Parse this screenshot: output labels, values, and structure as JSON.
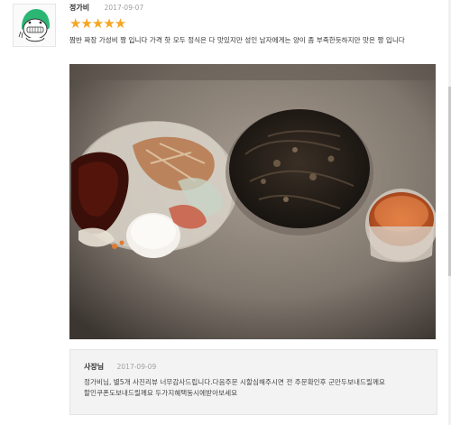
{
  "review": {
    "author": "정가비",
    "date": "2017-09-07",
    "rating": 5,
    "stars_display": "★★★★★",
    "text": "짬반 짜장 가성비 짱 입니다 가격 핫 모두 정식은 다 맛있지만 성인 남자에게는 양이 좀 부족한듯하지만 맛은 짱 입니다"
  },
  "owner_reply": {
    "name": "사장님",
    "date": "2017-09-09",
    "text": "정가비님, 별5개 사진리뷰 너무감사드립니다.다음주문 시할심해주시면 전 주문확인후 군만두보내드릴께요 할인쿠폰도보내드릴께요 두가지혜택동시에받아보세요"
  },
  "colors": {
    "star": "#f5a623",
    "author_text": "#333333",
    "date_text": "#a0a0a0",
    "reply_background": "#f3f3f3"
  }
}
